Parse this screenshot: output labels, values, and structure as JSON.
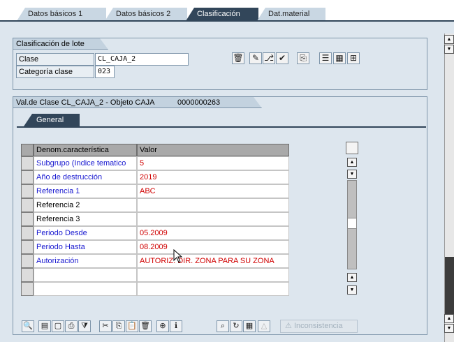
{
  "tabs": [
    {
      "label": "Datos básicos 1",
      "active": false
    },
    {
      "label": "Datos básicos 2",
      "active": false
    },
    {
      "label": "Clasificación",
      "active": true
    },
    {
      "label": "Dat.material",
      "active": false
    }
  ],
  "batch_class": {
    "title": "Clasificación de lote",
    "class_label": "Clase",
    "class_value": "CL_CAJA_2",
    "category_label": "Categoría clase",
    "category_value": "023"
  },
  "values_section": {
    "title": "Val.de Clase CL_CAJA_2 - Objeto CAJA",
    "object_number": "0000000263",
    "general_tab": "General"
  },
  "table": {
    "col_characteristic": "Denom.característica",
    "col_value": "Valor",
    "rows": [
      {
        "name": "Subgrupo (Indice tematico",
        "value": "5"
      },
      {
        "name": "Año de destrucción",
        "value": "2019"
      },
      {
        "name": "Referencia 1",
        "value": "ABC"
      },
      {
        "name": "Referencia 2",
        "value": ""
      },
      {
        "name": "Referencia 3",
        "value": ""
      },
      {
        "name": "Periodo Desde",
        "value": "05.2009"
      },
      {
        "name": "Periodo Hasta",
        "value": "08.2009"
      },
      {
        "name": "Autorización",
        "value": "AUTORIZ. DIR. ZONA PARA SU ZONA"
      },
      {
        "name": "",
        "value": ""
      },
      {
        "name": "",
        "value": ""
      }
    ]
  },
  "bottom_toolbar": {
    "inconsistency_label": "Inconsistencia"
  },
  "colors": {
    "dark_tab": "#32465a",
    "required_name": "#1a1ad0",
    "value_text": "#d00000"
  }
}
